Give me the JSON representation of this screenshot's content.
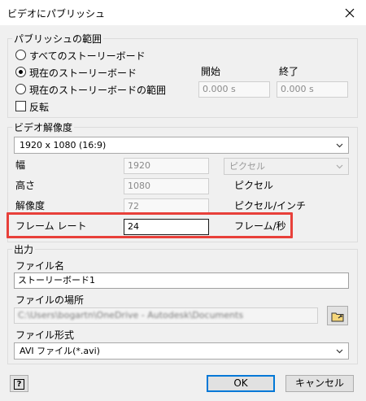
{
  "window": {
    "title": "ビデオにパブリッシュ"
  },
  "publish_range": {
    "group_label": "パブリッシュの範囲",
    "options": [
      {
        "label": "すべてのストーリーボード",
        "checked": false
      },
      {
        "label": "現在のストーリーボード",
        "checked": true
      },
      {
        "label": "現在のストーリーボードの範囲",
        "checked": false
      }
    ],
    "start_label": "開始",
    "end_label": "終了",
    "start_value": "0.000 s",
    "end_value": "0.000 s",
    "reverse_label": "反転"
  },
  "resolution": {
    "group_label": "ビデオ解像度",
    "preset": "1920 x 1080 (16:9)",
    "width_label": "幅",
    "width_value": "1920",
    "unit_select": "ピクセル",
    "height_label": "高さ",
    "height_value": "1080",
    "height_unit": "ピクセル",
    "dpi_label": "解像度",
    "dpi_value": "72",
    "dpi_unit": "ピクセル/インチ",
    "framerate_label": "フレーム レート",
    "framerate_value": "24",
    "framerate_unit": "フレーム/秒"
  },
  "output": {
    "group_label": "出力",
    "filename_label": "ファイル名",
    "filename_value": "ストーリーボード1",
    "location_label": "ファイルの場所",
    "location_value": "C:\\Users\\bogartn\\OneDrive - Autodesk\\Documents",
    "format_label": "ファイル形式",
    "format_value": "AVI ファイル(*.avi)"
  },
  "buttons": {
    "help_glyph": "?",
    "ok": "OK",
    "cancel": "キャンセル"
  },
  "colors": {
    "highlight": "#e8403a",
    "primary_border": "#0078d7"
  }
}
